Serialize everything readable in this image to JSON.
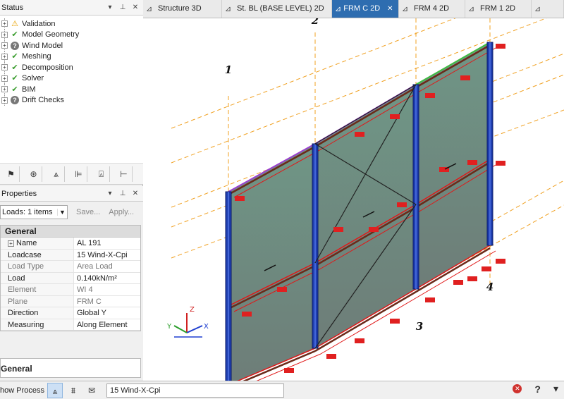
{
  "status_panel": {
    "title": "Status",
    "items": [
      {
        "label": "Validation",
        "state": "warning"
      },
      {
        "label": "Model Geometry",
        "state": "ok"
      },
      {
        "label": "Wind Model",
        "state": "unknown"
      },
      {
        "label": "Meshing",
        "state": "ok"
      },
      {
        "label": "Decomposition",
        "state": "ok"
      },
      {
        "label": "Solver",
        "state": "ok"
      },
      {
        "label": "BIM",
        "state": "ok"
      },
      {
        "label": "Drift Checks",
        "state": "unknown"
      }
    ]
  },
  "properties_panel": {
    "title": "Properties",
    "loads_select": "Loads: 1 items",
    "save_label": "Save...",
    "apply_label": "Apply...",
    "category": "General",
    "rows": [
      {
        "key": "Name",
        "value": "AL 191",
        "readonly": false,
        "expandable": true
      },
      {
        "key": "Loadcase",
        "value": "15 Wind-X-Cpi",
        "readonly": false
      },
      {
        "key": "Load Type",
        "value": "Area Load",
        "readonly": true
      },
      {
        "key": "Load",
        "value": "0.140kN/m²",
        "readonly": false
      },
      {
        "key": "Element",
        "value": "WI 4",
        "readonly": true
      },
      {
        "key": "Plane",
        "value": "FRM C",
        "readonly": true
      },
      {
        "key": "Direction",
        "value": "Global Y",
        "readonly": false
      },
      {
        "key": "Measuring",
        "value": "Along Element",
        "readonly": false
      }
    ],
    "description_title": "General"
  },
  "tabs": [
    {
      "label": "Structure 3D",
      "active": false
    },
    {
      "label": "St. BL (BASE LEVEL) 2D",
      "active": false
    },
    {
      "label": "FRM C 2D",
      "active": true
    },
    {
      "label": "FRM 4 2D",
      "active": false
    },
    {
      "label": "FRM 1 2D",
      "active": false
    },
    {
      "label": "",
      "active": false
    }
  ],
  "viewport": {
    "grid_labels": [
      "1",
      "2",
      "3",
      "4"
    ],
    "axis_labels": {
      "x": "X",
      "y": "Y",
      "z": "Z"
    }
  },
  "bottom_bar": {
    "show_process_label": "how Process",
    "loadcase_combo": "15 Wind-X-Cpi"
  },
  "colors": {
    "tab_active": "#2e6db0",
    "column": "#1f3fb0",
    "beam": "#e01818",
    "panel_fill": "#5f8a78",
    "grid_line": "#f0a020"
  }
}
